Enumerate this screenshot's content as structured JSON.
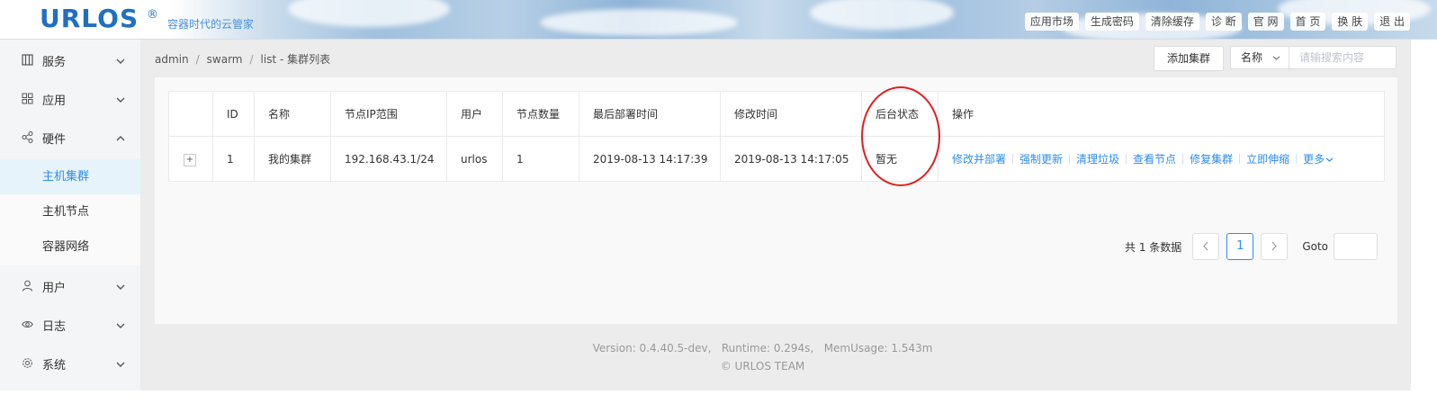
{
  "header": {
    "logo": "URLOS",
    "logo_mark": "®",
    "tagline": "容器时代的云管家",
    "nav": [
      "应用市场",
      "生成密码",
      "清除缓存",
      "诊 断",
      "官 网",
      "首 页",
      "换 肤",
      "退 出"
    ]
  },
  "sidebar": {
    "items": [
      {
        "label": "服务",
        "icon": "grid-icon",
        "expanded": false
      },
      {
        "label": "应用",
        "icon": "apps-icon",
        "expanded": false
      },
      {
        "label": "硬件",
        "icon": "share-icon",
        "expanded": true
      },
      {
        "label": "用户",
        "icon": "user-icon",
        "expanded": false
      },
      {
        "label": "日志",
        "icon": "eye-icon",
        "expanded": false
      },
      {
        "label": "系统",
        "icon": "gear-icon",
        "expanded": false
      }
    ],
    "subitems": [
      {
        "label": "主机集群",
        "active": true
      },
      {
        "label": "主机节点",
        "active": false
      },
      {
        "label": "容器网络",
        "active": false
      }
    ]
  },
  "breadcrumb": {
    "parts": [
      "admin",
      "swarm",
      "list"
    ],
    "title": "集群列表"
  },
  "toolbar": {
    "add_label": "添加集群",
    "select_label": "名称",
    "search_placeholder": "请输搜索内容"
  },
  "table": {
    "columns": [
      "",
      "ID",
      "名称",
      "节点IP范围",
      "用户",
      "节点数量",
      "最后部署时间",
      "修改时间",
      "后台状态",
      "操作"
    ],
    "rows": [
      {
        "expand": "+",
        "id": "1",
        "name": "我的集群",
        "ip_range": "192.168.43.1/24",
        "user": "urlos",
        "node_count": "1",
        "last_deploy": "2019-08-13 14:17:39",
        "modified": "2019-08-13 14:17:05",
        "status": "暂无",
        "actions": [
          "修改并部署",
          "强制更新",
          "清理垃圾",
          "查看节点",
          "修复集群",
          "立即伸缩",
          "更多"
        ]
      }
    ]
  },
  "pagination": {
    "total_text": "共 1 条数据",
    "prev": "‹",
    "current": "1",
    "next": "›",
    "goto_label": "Goto"
  },
  "footer": {
    "line1": "Version: 0.4.40.5-dev,   Runtime: 0.294s,   MemUsage: 1.543m",
    "line2": "© URLOS TEAM"
  },
  "colors": {
    "accent": "#2d8cf0",
    "logo": "#1f6fc3",
    "highlight_circle": "#e02020"
  }
}
